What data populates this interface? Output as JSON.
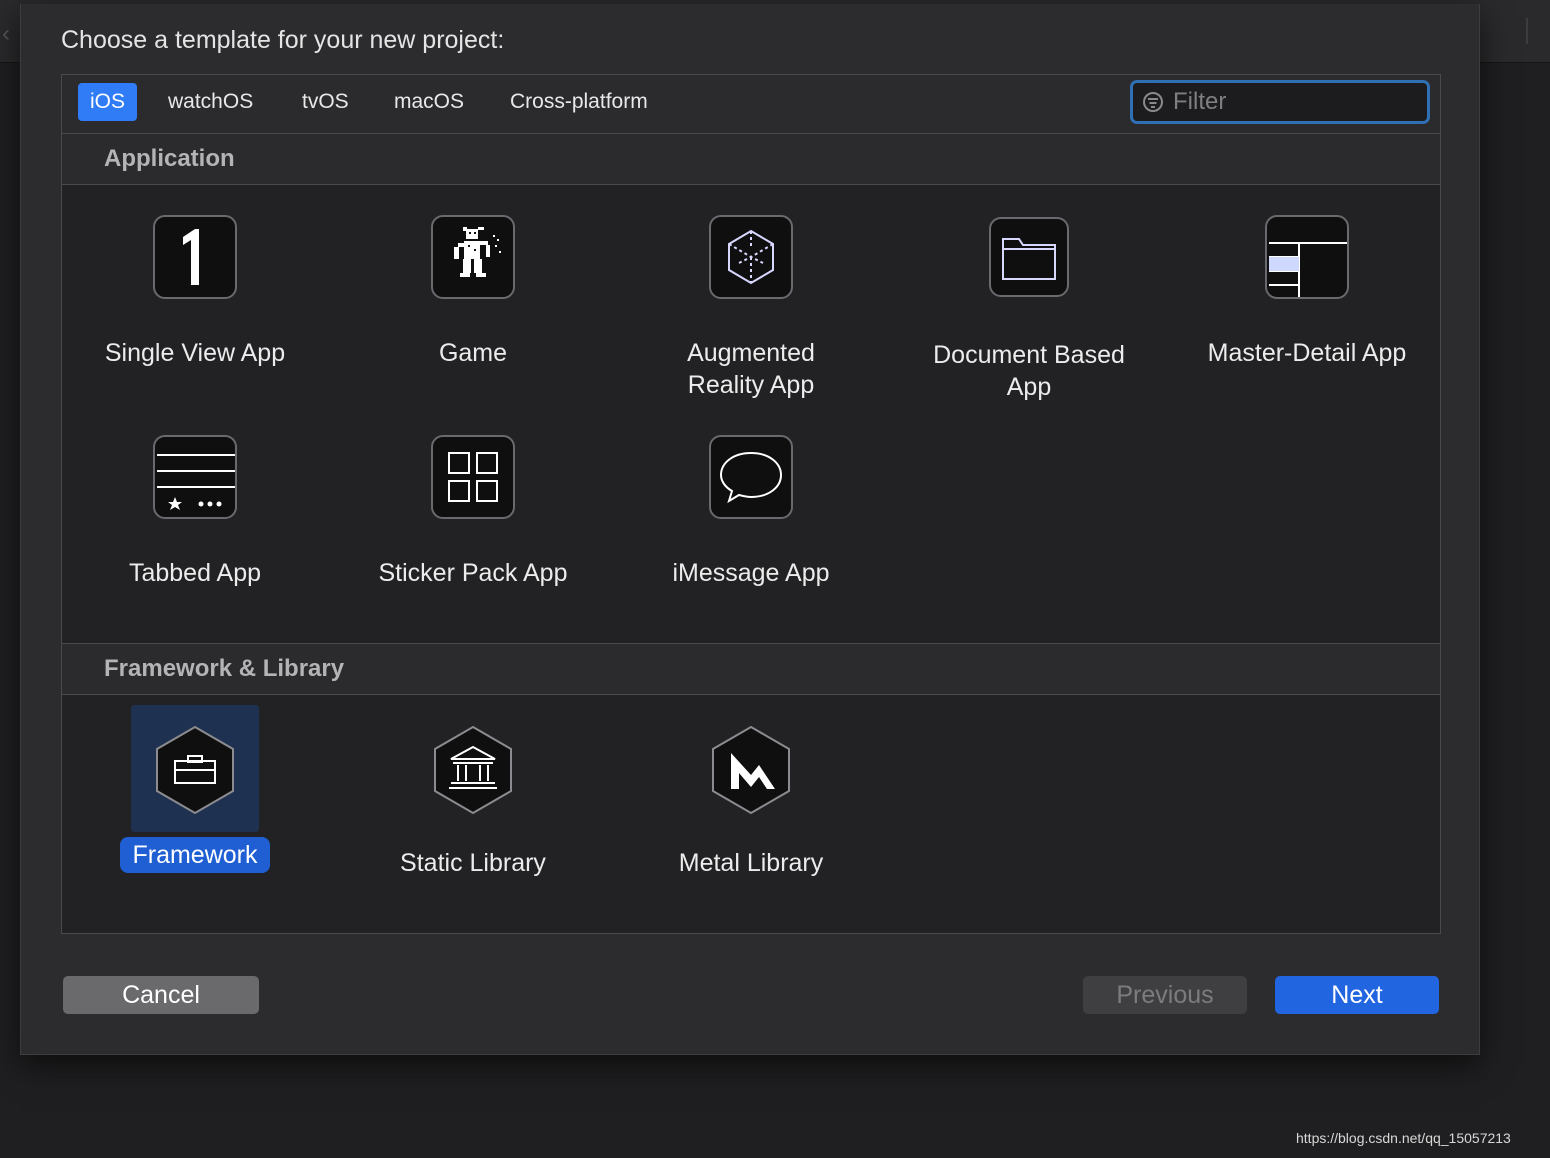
{
  "dialog": {
    "title": "Choose a template for your new project:"
  },
  "tabs": [
    {
      "label": "iOS",
      "active": true
    },
    {
      "label": "watchOS",
      "active": false
    },
    {
      "label": "tvOS",
      "active": false
    },
    {
      "label": "macOS",
      "active": false
    },
    {
      "label": "Cross-platform",
      "active": false
    }
  ],
  "filter": {
    "placeholder": "Filter",
    "value": ""
  },
  "sections": [
    {
      "title": "Application",
      "templates": [
        {
          "label": "Single View App",
          "icon": "single-view-app-icon"
        },
        {
          "label": "Game",
          "icon": "game-icon"
        },
        {
          "label": "Augmented Reality App",
          "icon": "augmented-reality-app-icon"
        },
        {
          "label": "Document Based App",
          "icon": "document-based-app-icon"
        },
        {
          "label": "Master-Detail App",
          "icon": "master-detail-app-icon"
        },
        {
          "label": "Tabbed App",
          "icon": "tabbed-app-icon"
        },
        {
          "label": "Sticker Pack App",
          "icon": "sticker-pack-app-icon"
        },
        {
          "label": "iMessage App",
          "icon": "imessage-app-icon"
        }
      ]
    },
    {
      "title": "Framework & Library",
      "templates": [
        {
          "label": "Framework",
          "icon": "framework-icon",
          "selected": true
        },
        {
          "label": "Static Library",
          "icon": "static-library-icon"
        },
        {
          "label": "Metal Library",
          "icon": "metal-library-icon"
        }
      ]
    }
  ],
  "buttons": {
    "cancel": "Cancel",
    "previous": "Previous",
    "next": "Next"
  },
  "watermark": "https://blog.csdn.net/qq_15057213",
  "colors": {
    "accent": "#2f7cf6",
    "selection": "#1f5fd3",
    "background": "#2c2c2e"
  }
}
